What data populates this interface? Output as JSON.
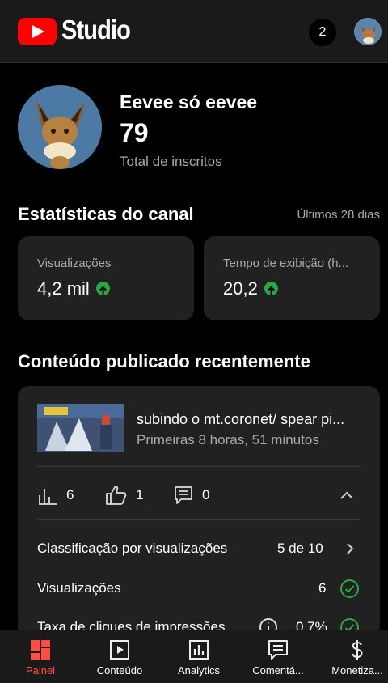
{
  "header": {
    "app_name": "Studio",
    "notification_count": "2"
  },
  "channel": {
    "name": "Eevee só eevee",
    "subscribers": "79",
    "subscribers_label": "Total de inscritos"
  },
  "stats": {
    "title": "Estatísticas do canal",
    "range": "Últimos 28 dias",
    "cards": [
      {
        "label": "Visualizações",
        "value": "4,2 mil",
        "trend": "up"
      },
      {
        "label": "Tempo de exibição (h...",
        "value": "20,2",
        "trend": "up"
      }
    ]
  },
  "recent": {
    "title": "Conteúdo publicado recentemente",
    "video_title": "subindo o mt.coronet/ spear pi...",
    "video_subtitle": "Primeiras 8 horas, 51 minutos",
    "metrics": {
      "views": "6",
      "likes": "1",
      "comments": "0"
    },
    "rows": [
      {
        "label": "Classificação por visualizações",
        "value": "5 de 10",
        "icon": "chevron-right-icon"
      },
      {
        "label": "Visualizações",
        "value": "6",
        "icon": "check-circle-icon"
      },
      {
        "label": "Taxa de cliques de impressões",
        "value": "0,7%",
        "icon": "check-circle-icon"
      }
    ]
  },
  "nav": {
    "items": [
      {
        "label": "Painel",
        "icon": "dashboard-icon",
        "active": true
      },
      {
        "label": "Conteúdo",
        "icon": "content-icon",
        "active": false
      },
      {
        "label": "Analytics",
        "icon": "analytics-icon",
        "active": false
      },
      {
        "label": "Comentá...",
        "icon": "comments-icon",
        "active": false
      },
      {
        "label": "Monetiza...",
        "icon": "dollar-icon",
        "active": false
      }
    ]
  },
  "colors": {
    "brand": "#ff0000",
    "active_nav": "#ff4e45",
    "positive": "#2ba640",
    "card_bg": "#212121"
  }
}
